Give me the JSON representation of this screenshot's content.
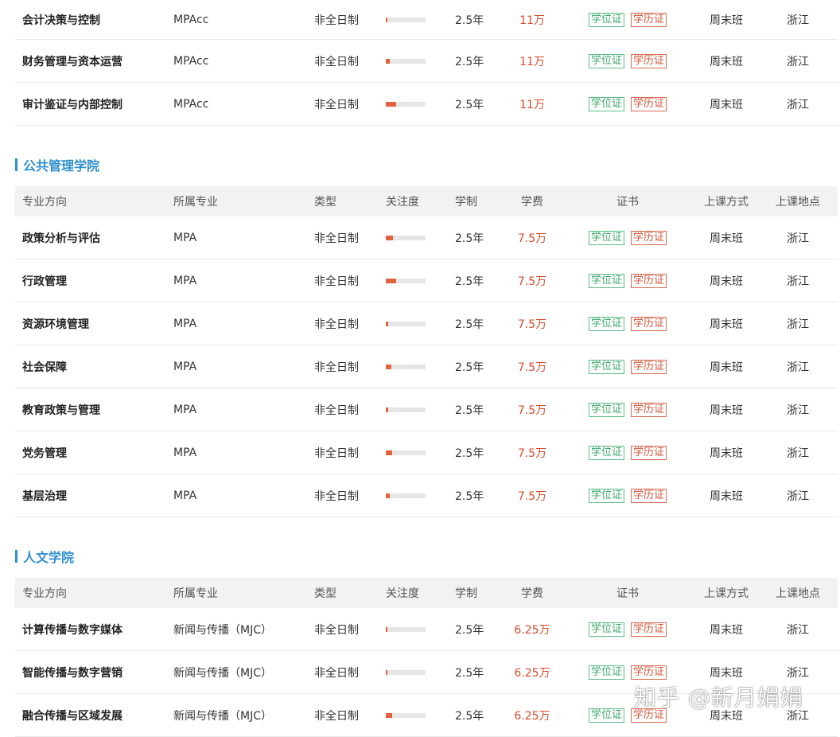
{
  "headers": {
    "direction": "专业方向",
    "major": "所属专业",
    "type": "类型",
    "attention": "关注度",
    "duration": "学制",
    "fee": "学费",
    "cert": "证书",
    "mode": "上课方式",
    "location": "上课地点"
  },
  "badges": {
    "degree": "学位证",
    "diploma": "学历证"
  },
  "colors": {
    "accent": "#2f8fd0",
    "fee": "#d84a2b",
    "bar": "#e2623e",
    "degree": "#3aa86a",
    "diploma": "#d0563a"
  },
  "top_rows": [
    {
      "direction": "会计决策与控制",
      "major": "MPAcc",
      "type": "非全日制",
      "attention": 0.03,
      "duration": "2.5年",
      "fee": "11万",
      "mode": "周末班",
      "location": "浙江"
    },
    {
      "direction": "财务管理与资本运营",
      "major": "MPAcc",
      "type": "非全日制",
      "attention": 0.1,
      "duration": "2.5年",
      "fee": "11万",
      "mode": "周末班",
      "location": "浙江"
    },
    {
      "direction": "审计鉴证与内部控制",
      "major": "MPAcc",
      "type": "非全日制",
      "attention": 0.26,
      "duration": "2.5年",
      "fee": "11万",
      "mode": "周末班",
      "location": "浙江"
    }
  ],
  "sections": [
    {
      "title": "公共管理学院",
      "rows": [
        {
          "direction": "政策分析与评估",
          "major": "MPA",
          "type": "非全日制",
          "attention": 0.18,
          "duration": "2.5年",
          "fee": "7.5万",
          "mode": "周末班",
          "location": "浙江"
        },
        {
          "direction": "行政管理",
          "major": "MPA",
          "type": "非全日制",
          "attention": 0.26,
          "duration": "2.5年",
          "fee": "7.5万",
          "mode": "周末班",
          "location": "浙江"
        },
        {
          "direction": "资源环境管理",
          "major": "MPA",
          "type": "非全日制",
          "attention": 0.06,
          "duration": "2.5年",
          "fee": "7.5万",
          "mode": "周末班",
          "location": "浙江"
        },
        {
          "direction": "社会保障",
          "major": "MPA",
          "type": "非全日制",
          "attention": 0.13,
          "duration": "2.5年",
          "fee": "7.5万",
          "mode": "周末班",
          "location": "浙江"
        },
        {
          "direction": "教育政策与管理",
          "major": "MPA",
          "type": "非全日制",
          "attention": 0.05,
          "duration": "2.5年",
          "fee": "7.5万",
          "mode": "周末班",
          "location": "浙江"
        },
        {
          "direction": "党务管理",
          "major": "MPA",
          "type": "非全日制",
          "attention": 0.15,
          "duration": "2.5年",
          "fee": "7.5万",
          "mode": "周末班",
          "location": "浙江"
        },
        {
          "direction": "基层治理",
          "major": "MPA",
          "type": "非全日制",
          "attention": 0.09,
          "duration": "2.5年",
          "fee": "7.5万",
          "mode": "周末班",
          "location": "浙江"
        }
      ]
    },
    {
      "title": "人文学院",
      "rows": [
        {
          "direction": "计算传播与数字媒体",
          "major": "新闻与传播（MJC）",
          "type": "非全日制",
          "attention": 0.03,
          "duration": "2.5年",
          "fee": "6.25万",
          "mode": "周末班",
          "location": "浙江"
        },
        {
          "direction": "智能传播与数字营销",
          "major": "新闻与传播（MJC）",
          "type": "非全日制",
          "attention": 0.04,
          "duration": "2.5年",
          "fee": "6.25万",
          "mode": "周末班",
          "location": "浙江"
        },
        {
          "direction": "融合传播与区域发展",
          "major": "新闻与传播（MJC）",
          "type": "非全日制",
          "attention": 0.15,
          "duration": "2.5年",
          "fee": "6.25万",
          "mode": "周末班",
          "location": "浙江"
        }
      ]
    }
  ],
  "watermark": "知乎 @新月娟娟"
}
